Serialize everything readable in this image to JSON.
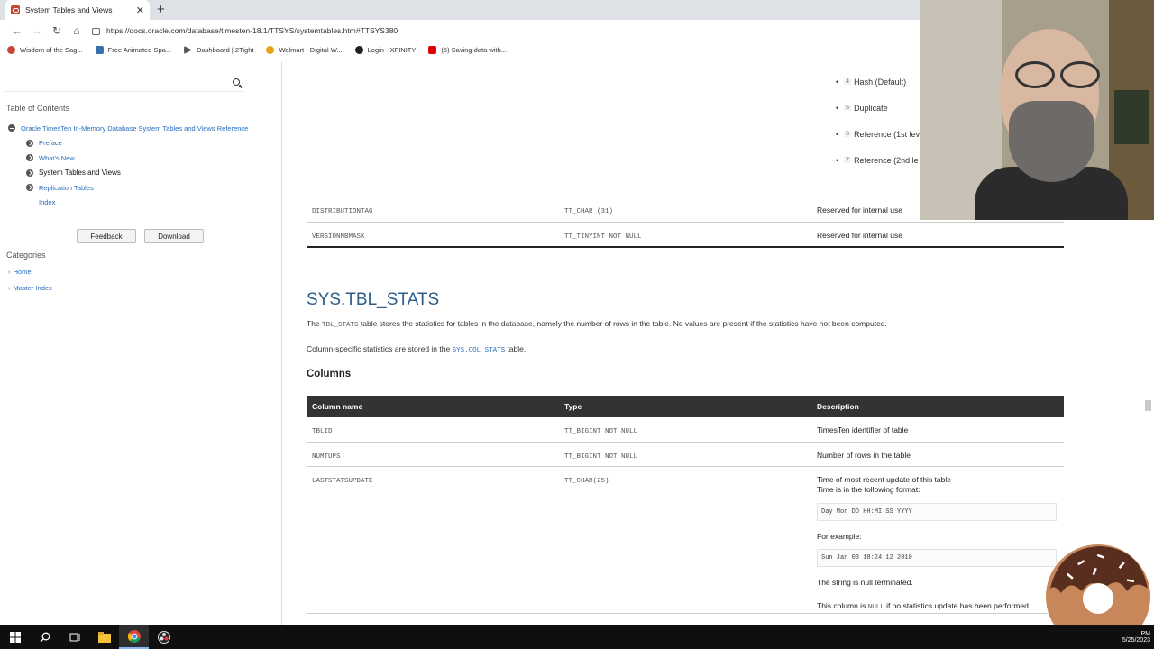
{
  "browser": {
    "tab_title": "System Tables and Views",
    "url": "https://docs.oracle.com/database/timesten-18.1/TTSYS/systemtables.htm#TTSYS380",
    "bookmarks": [
      {
        "label": "Wisdom of the Sag...",
        "color": "#c74634"
      },
      {
        "label": "Free Animated Spa...",
        "color": "#3a6fb0"
      },
      {
        "label": "Dashboard | 2Tight",
        "color": "#555555"
      },
      {
        "label": "Walmart - Digital W...",
        "color": "#e8a317"
      },
      {
        "label": "Login - XFINITY",
        "color": "#222222"
      },
      {
        "label": "(5) Saving data with...",
        "color": "#e00000"
      }
    ]
  },
  "sidebar": {
    "toc_title": "Table of Contents",
    "toc": [
      {
        "label": "Oracle TimesTen In-Memory Database System Tables and Views Reference",
        "level": 1,
        "icon": "open"
      },
      {
        "label": "Preface",
        "level": 2,
        "icon": "closed"
      },
      {
        "label": "What's New",
        "level": 2,
        "icon": "closed"
      },
      {
        "label": "System Tables and Views",
        "level": 2,
        "icon": "closed",
        "active": true
      },
      {
        "label": "Replication Tables",
        "level": 2,
        "icon": "closed"
      },
      {
        "label": "Index",
        "level": 3,
        "icon": "none"
      }
    ],
    "feedback_label": "Feedback",
    "download_label": "Download",
    "categories_title": "Categories",
    "categories": [
      "Home",
      "Master Index"
    ]
  },
  "main": {
    "bullets": [
      {
        "num": "4",
        "label": "Hash (Default)"
      },
      {
        "num": "5",
        "label": "Duplicate"
      },
      {
        "num": "6",
        "label": "Reference (1st lev"
      },
      {
        "num": "7",
        "label": "Reference (2nd le"
      }
    ],
    "prev_table": [
      {
        "name": "DISTRIBUTIONTAG",
        "type": "TT_CHAR (31)",
        "desc": "Reserved for internal use"
      },
      {
        "name": "VERSIONNBMASK",
        "type": "TT_TINYINT NOT NULL",
        "desc": "Reserved for internal use"
      }
    ],
    "heading": "SYS.TBL_STATS",
    "para1_pre": "The ",
    "para1_code": "TBL_STATS",
    "para1_post": " table stores the statistics for tables in the database, namely the number of rows in the table. No values are present if the statistics have not been computed.",
    "para2_pre": "Column-specific statistics are stored in the ",
    "para2_code": "SYS.COL_STATS",
    "para2_post": " table.",
    "columns_heading": "Columns",
    "table_headers": [
      "Column name",
      "Type",
      "Description"
    ],
    "rows": [
      {
        "name": "TBLID",
        "type": "TT_BIGINT NOT NULL",
        "desc": "TimesTen identifier of table"
      },
      {
        "name": "NUMTUPS",
        "type": "TT_BIGINT NOT NULL",
        "desc": "Number of rows in the table"
      },
      {
        "name": "LASTSTATSUPDATE",
        "type": "TT_CHAR(25)",
        "desc": "Time of most recent update of this table"
      }
    ],
    "last_desc": {
      "line2": "Time is in the following format:",
      "format": "Day Mon DD HH:MI:SS YYYY",
      "example_label": "For example:",
      "example": "Sun Jan 03 18:24:12 2010",
      "null_term": "The string is null terminated.",
      "null_pre": "This column is ",
      "null_code": "NULL",
      "null_post": " if no statistics update has been performed."
    }
  },
  "taskbar": {
    "time": "PM",
    "date": "5/25/2023"
  }
}
